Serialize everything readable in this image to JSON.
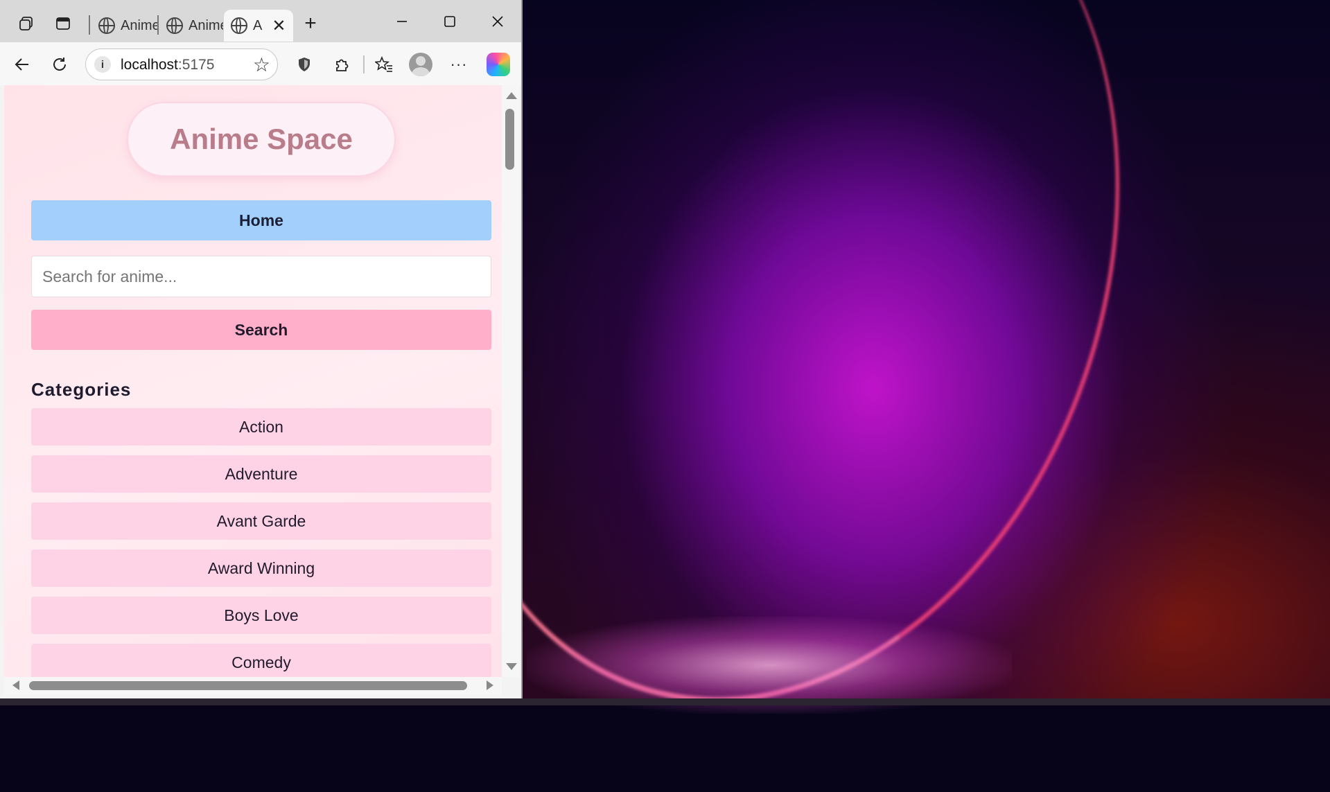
{
  "browser": {
    "tabs": [
      {
        "label": "Anime"
      },
      {
        "label": "Anime"
      },
      {
        "label": "A"
      }
    ],
    "address": {
      "host": "localhost",
      "port": ":5175"
    }
  },
  "page": {
    "logo": "Anime Space",
    "home_label": "Home",
    "search_placeholder": "Search for anime...",
    "search_label": "Search",
    "categories_heading": "Categories",
    "categories": [
      "Action",
      "Adventure",
      "Avant Garde",
      "Award Winning",
      "Boys Love",
      "Comedy"
    ]
  },
  "colors": {
    "home_button": "#a3cffd",
    "search_button": "#ffafca",
    "category_item": "#ffd3e6",
    "logo_text": "#b97c8a"
  }
}
